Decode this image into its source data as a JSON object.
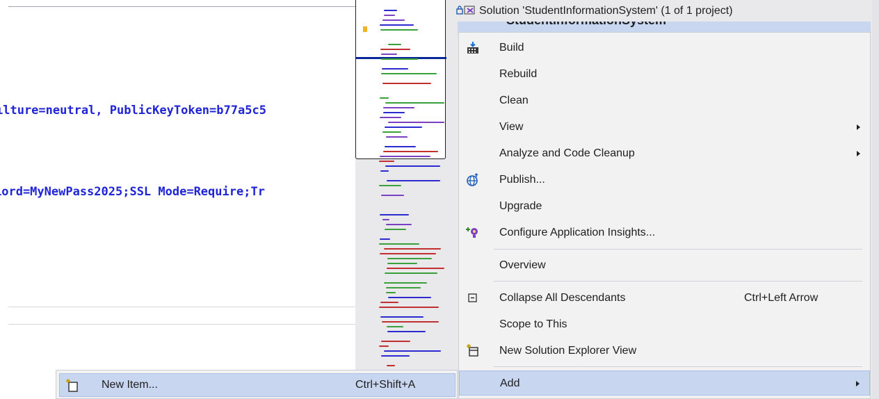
{
  "editor": {
    "line1": "ılture=neutral, PublicKeyToken=b77a5c5",
    "line2": "ıord=MyNewPass2025;SSL Mode=Require;Tr"
  },
  "solution_explorer": {
    "solution_label": "Solution 'StudentInformationSystem' (1 of 1 project)",
    "project_label": "StudentInformationSystem"
  },
  "context_menu": {
    "items": [
      {
        "label": "Build",
        "icon": "build-icon"
      },
      {
        "label": "Rebuild"
      },
      {
        "label": "Clean"
      },
      {
        "label": "View",
        "has_submenu": true
      },
      {
        "label": "Analyze and Code Cleanup",
        "has_submenu": true
      },
      {
        "label": "Publish...",
        "icon": "publish-globe-icon"
      },
      {
        "label": "Upgrade"
      },
      {
        "label": "Configure Application Insights...",
        "icon": "lightbulb-icon"
      },
      {
        "label": "Overview"
      },
      {
        "label": "Collapse All Descendants",
        "shortcut": "Ctrl+Left Arrow",
        "icon": "collapse-icon"
      },
      {
        "label": "Scope to This"
      },
      {
        "label": "New Solution Explorer View",
        "icon": "new-view-icon"
      },
      {
        "label": "Add",
        "has_submenu": true,
        "highlighted": true
      }
    ]
  },
  "submenu": {
    "item_label": "New Item...",
    "item_shortcut": "Ctrl+Shift+A",
    "icon": "new-item-icon"
  },
  "colors": {
    "highlight": "#c9d6f0",
    "menu_bg": "#f2f2f2",
    "code_blue": "#1f24d6"
  }
}
